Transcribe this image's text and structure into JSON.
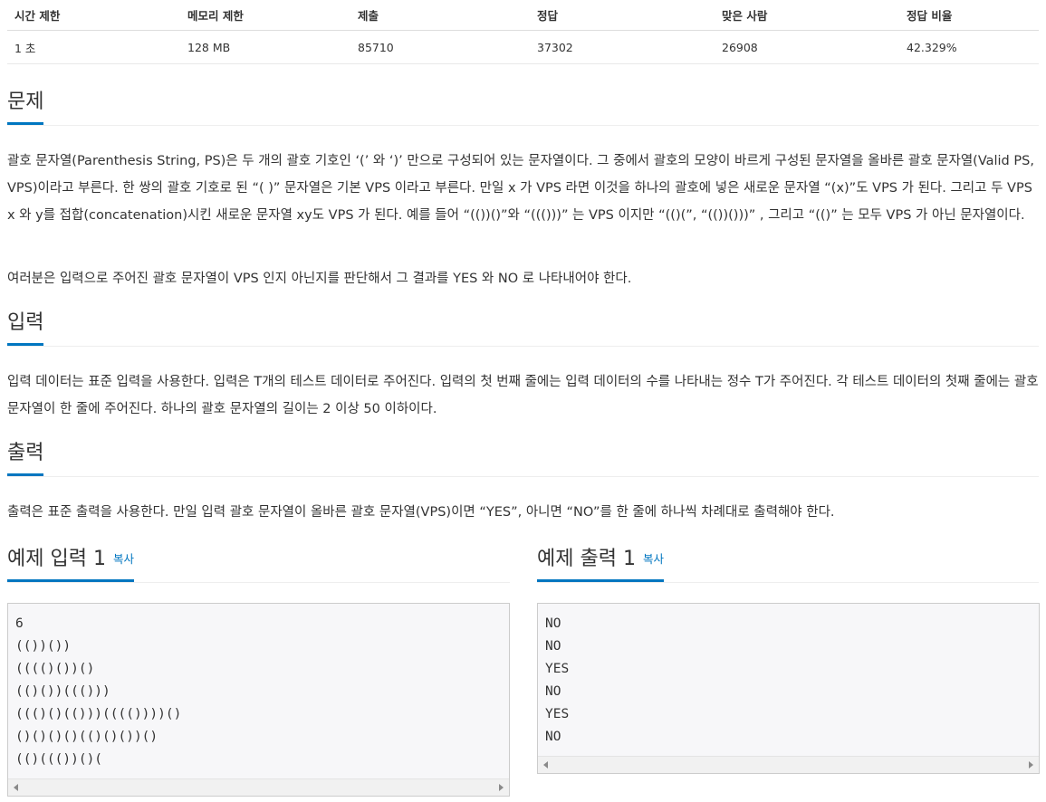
{
  "stats": {
    "headers": [
      "시간 제한",
      "메모리 제한",
      "제출",
      "정답",
      "맞은 사람",
      "정답 비율"
    ],
    "values": [
      "1 초",
      "128 MB",
      "85710",
      "37302",
      "26908",
      "42.329%"
    ]
  },
  "problem": {
    "title": "문제",
    "para1": "괄호 문자열(Parenthesis String, PS)은 두 개의 괄호 기호인 ‘(’ 와 ‘)’ 만으로 구성되어 있는 문자열이다. 그 중에서 괄호의 모양이 바르게 구성된 문자열을 올바른 괄호 문자열(Valid PS, VPS)이라고 부른다. 한 쌍의 괄호 기호로 된 “( )” 문자열은 기본 VPS 이라고 부른다. 만일 x 가 VPS 라면 이것을 하나의 괄호에 넣은 새로운 문자열 “(x)”도 VPS 가 된다. 그리고 두 VPS x 와 y를 접합(concatenation)시킨 새로운 문자열 xy도 VPS 가 된다. 예를 들어 “(())()”와 “((()))” 는 VPS 이지만 “(()(”, “(())()))” , 그리고 “(()” 는 모두 VPS 가 아닌 문자열이다.",
    "para2": "여러분은 입력으로 주어진 괄호 문자열이 VPS 인지 아닌지를 판단해서 그 결과를 YES 와 NO 로 나타내어야 한다."
  },
  "input": {
    "title": "입력",
    "text": "입력 데이터는 표준 입력을 사용한다. 입력은 T개의 테스트 데이터로 주어진다. 입력의 첫 번째 줄에는 입력 데이터의 수를 나타내는 정수 T가 주어진다. 각 테스트 데이터의 첫째 줄에는 괄호 문자열이 한 줄에 주어진다. 하나의 괄호 문자열의 길이는 2 이상 50 이하이다."
  },
  "output": {
    "title": "출력",
    "text": "출력은 표준 출력을 사용한다. 만일 입력 괄호 문자열이 올바른 괄호 문자열(VPS)이면 “YES”, 아니면 “NO”를 한 줄에 하나씩 차례대로 출력해야 한다."
  },
  "sample_input": {
    "title": "예제 입력 1",
    "copy_label": "복사",
    "lines": [
      "6",
      "(())())",
      "(((()())()",
      "(()())((()))",
      "((()()(()))(((())))()",
      "()()()()(()()())()",
      "(()((())()("
    ]
  },
  "sample_output": {
    "title": "예제 출력 1",
    "copy_label": "복사",
    "lines": [
      "NO",
      "NO",
      "YES",
      "NO",
      "YES",
      "NO"
    ]
  }
}
